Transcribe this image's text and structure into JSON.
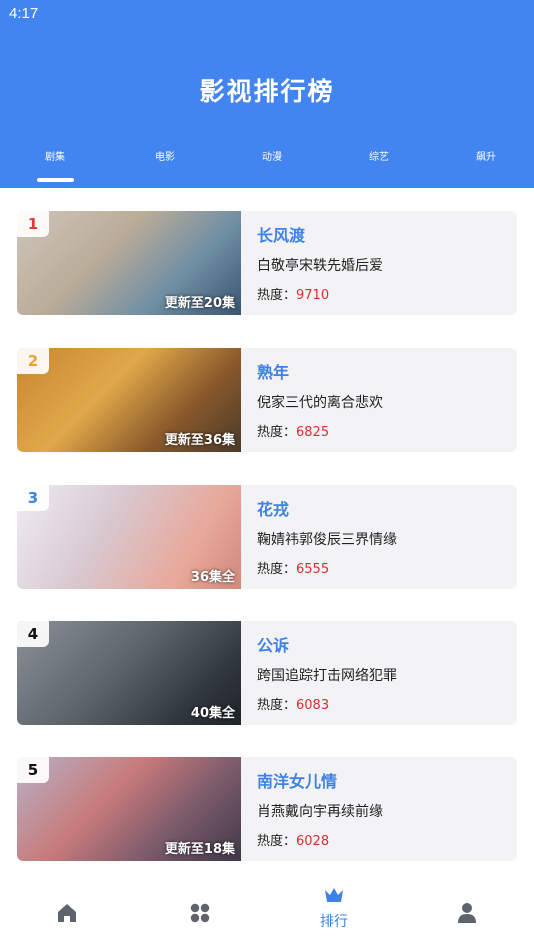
{
  "status_bar": {
    "time": "4:17"
  },
  "header": {
    "title": "影视排行榜"
  },
  "tabs": [
    {
      "label": "剧集",
      "active": true
    },
    {
      "label": "电影",
      "active": false
    },
    {
      "label": "动漫",
      "active": false
    },
    {
      "label": "综艺",
      "active": false
    },
    {
      "label": "飙升",
      "active": false
    }
  ],
  "colors": {
    "brand": "#4285f0",
    "title_blue": "#3d82e6",
    "heat_red": "#e02b2b"
  },
  "ranking": {
    "heat_label": "热度：",
    "items": [
      {
        "rank": "1",
        "rank_color": "#e53935",
        "title": "长风渡",
        "desc": "白敬亭宋轶先婚后爱",
        "heat": "9710",
        "episodes": "更新至20集"
      },
      {
        "rank": "2",
        "rank_color": "#f0a030",
        "title": "熟年",
        "desc": "倪家三代的离合悲欢",
        "heat": "6825",
        "episodes": "更新至36集"
      },
      {
        "rank": "3",
        "rank_color": "#3d82e6",
        "title": "花戎",
        "desc": "鞠婧祎郭俊辰三界情缘",
        "heat": "6555",
        "episodes": "36集全"
      },
      {
        "rank": "4",
        "rank_color": "#111111",
        "title": "公诉",
        "desc": "跨国追踪打击网络犯罪",
        "heat": "6083",
        "episodes": "40集全"
      },
      {
        "rank": "5",
        "rank_color": "#111111",
        "title": "南洋女儿情",
        "desc": "肖燕戴向宇再续前缘",
        "heat": "6028",
        "episodes": "更新至18集"
      }
    ]
  },
  "bottom_nav": [
    {
      "icon": "home-icon",
      "label": ""
    },
    {
      "icon": "category-icon",
      "label": ""
    },
    {
      "icon": "crown-icon",
      "label": "排行",
      "active": true
    },
    {
      "icon": "user-icon",
      "label": ""
    }
  ]
}
